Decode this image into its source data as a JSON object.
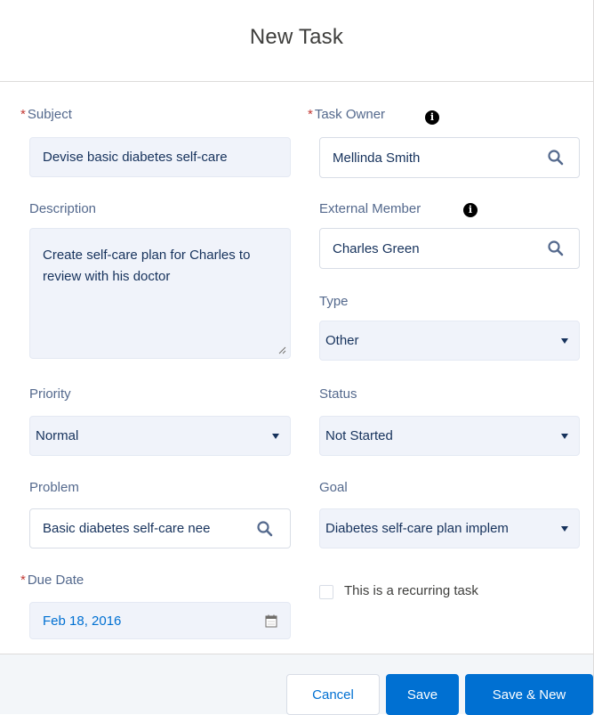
{
  "modal": {
    "title": "New Task"
  },
  "form": {
    "subject": {
      "label": "Subject",
      "required": "*",
      "value": "Devise basic diabetes self-care"
    },
    "task_owner": {
      "label": "Task Owner",
      "required": "*",
      "value": "Mellinda Smith"
    },
    "description": {
      "label": "Description",
      "value": "Create self-care plan for Charles to review with his doctor"
    },
    "external_member": {
      "label": "External Member",
      "value": "Charles Green"
    },
    "type": {
      "label": "Type",
      "value": "Other"
    },
    "priority": {
      "label": "Priority",
      "value": "Normal"
    },
    "status": {
      "label": "Status",
      "value": "Not Started"
    },
    "problem": {
      "label": "Problem",
      "value": "Basic diabetes self-care nee"
    },
    "goal": {
      "label": "Goal",
      "value": "Diabetes self-care plan implem"
    },
    "due_date": {
      "label": "Due Date",
      "required": "*",
      "value": "Feb 18, 2016"
    },
    "recurring": {
      "label": "This is a recurring task",
      "checked": false
    }
  },
  "footer": {
    "cancel_label": "Cancel",
    "save_label": "Save",
    "save_new_label": "Save & New"
  },
  "icons": {
    "info": "i",
    "search": "search-icon",
    "calendar": "calendar-icon"
  },
  "colors": {
    "brand": "#0070d2",
    "required": "#c23934",
    "field_bg": "#f0f3fa",
    "label": "#54698d"
  }
}
